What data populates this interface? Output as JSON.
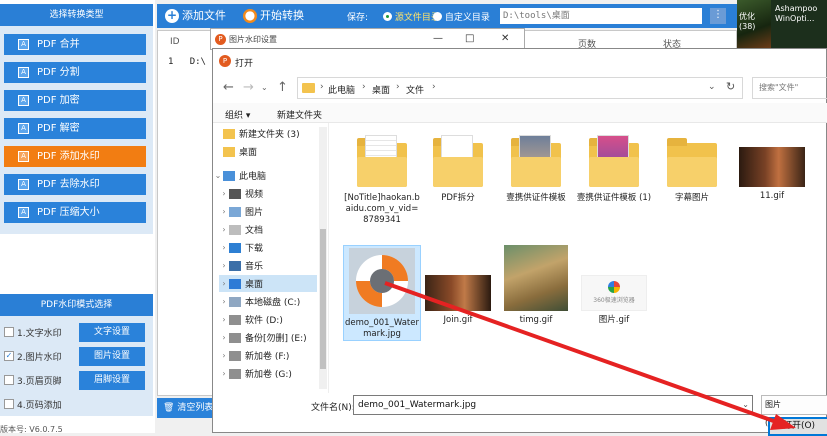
{
  "left_panel": {
    "header": "选择转换类型",
    "types": [
      {
        "label": "PDF 合并"
      },
      {
        "label": "PDF 分割"
      },
      {
        "label": "PDF 加密"
      },
      {
        "label": "PDF 解密"
      },
      {
        "label": "PDF 添加水印"
      },
      {
        "label": "PDF 去除水印"
      },
      {
        "label": "PDF 压缩大小"
      }
    ],
    "watermark_header": "PDF水印模式选择",
    "watermark_modes": [
      {
        "label": "1.文字水印",
        "checked": false,
        "button": "文字设置"
      },
      {
        "label": "2.图片水印",
        "checked": true,
        "button": "图片设置"
      },
      {
        "label": "3.页眉页脚",
        "checked": false,
        "button": "眉脚设置"
      },
      {
        "label": "4.页码添加",
        "checked": false,
        "button": ""
      }
    ],
    "version": "版本号: V6.0.7.5"
  },
  "toolbar": {
    "add_file": "添加文件",
    "start": "开始转换",
    "save_label": "保存:",
    "save_source": "源文件目录",
    "save_custom": "自定义目录",
    "save_path": "D:\\tools\\桌面",
    "browse": "⋮"
  },
  "file_table": {
    "columns": [
      "ID",
      "页数",
      "状态"
    ],
    "row_id": "1",
    "row_text": "D:\\",
    "clear_button": "清空列表"
  },
  "desktop": {
    "item1_line1": "优化",
    "item1_line2": "(38)",
    "item2_line1": "Ashampoo",
    "item2_line2": "WinOpti..."
  },
  "watermark_dialog": {
    "title": "图片水印设置",
    "icon": "app-icon"
  },
  "open_dialog": {
    "title": "打开",
    "breadcrumb": [
      "此电脑",
      "桌面",
      "文件"
    ],
    "search_placeholder": "搜索\"文件\"",
    "organize": "组织 ▾",
    "new_folder": "新建文件夹",
    "tree": [
      {
        "label": "新建文件夹 (3)",
        "icon": "folder"
      },
      {
        "label": "桌面",
        "icon": "folder"
      },
      {
        "label": "此电脑",
        "icon": "pc",
        "expanded": true
      },
      {
        "label": "视频",
        "icon": "video"
      },
      {
        "label": "图片",
        "icon": "picture"
      },
      {
        "label": "文档",
        "icon": "document"
      },
      {
        "label": "下载",
        "icon": "download"
      },
      {
        "label": "音乐",
        "icon": "music"
      },
      {
        "label": "桌面",
        "icon": "desktop",
        "selected": true
      },
      {
        "label": "本地磁盘 (C:)",
        "icon": "drive"
      },
      {
        "label": "软件 (D:)",
        "icon": "drive"
      },
      {
        "label": "备份[勿删] (E:)",
        "icon": "drive"
      },
      {
        "label": "新加卷 (F:)",
        "icon": "drive"
      },
      {
        "label": "新加卷 (G:)",
        "icon": "drive"
      }
    ],
    "files": [
      {
        "label": "[NoTitle]haokan.baidu.com_v_vid=8789341",
        "kind": "folder-doc"
      },
      {
        "label": "PDF拆分",
        "kind": "folder"
      },
      {
        "label": "壹携供证件模板",
        "kind": "folder-img"
      },
      {
        "label": "壹携供证件模板 (1)",
        "kind": "folder-img2"
      },
      {
        "label": "字幕图片",
        "kind": "folder"
      },
      {
        "label": "11.gif",
        "kind": "gif-dark"
      },
      {
        "label": "demo_001_Watermark.jpg",
        "kind": "lifebuoy",
        "selected": true
      },
      {
        "label": "Join.gif",
        "kind": "gif-dark"
      },
      {
        "label": "timg.gif",
        "kind": "anime"
      },
      {
        "label": "图片.gif",
        "kind": "logo"
      }
    ],
    "logo_text": "360极速浏览器",
    "filename_label": "文件名(N):",
    "filename_value": "demo_001_Watermark.jpg",
    "filetype_value": "图片 (*.jpg;*.jpg",
    "open_button": "打开(O)"
  },
  "colors": {
    "primary_blue": "#2a7fd6",
    "active_orange": "#f27d12",
    "arrow_red": "#e52222"
  }
}
